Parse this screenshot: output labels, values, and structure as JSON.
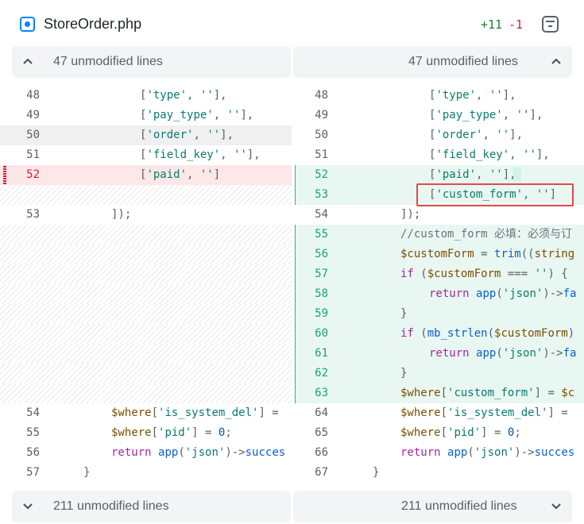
{
  "header": {
    "file_name": "StoreOrder.php",
    "additions": "+11",
    "deletions": "-1",
    "file_icon": "file-circle-icon",
    "collapse_icon": "collapse-icon"
  },
  "expand_top": {
    "left_label": "47 unmodified lines",
    "right_label": "47 unmodified lines",
    "icon": "chevron-up-icon"
  },
  "expand_bottom": {
    "left_label": "211 unmodified lines",
    "right_label": "211 unmodified lines",
    "icon": "chevron-down-icon"
  },
  "colors": {
    "addition": "#1a7f37",
    "deletion": "#cf222e",
    "added_line_bg": "#e8f7f1",
    "deleted_line_bg": "#fde7e8",
    "highlight_box": "#e5484d"
  },
  "left_lines": [
    {
      "num": "48",
      "code": "['type', ''],",
      "kind": "ctx"
    },
    {
      "num": "49",
      "code": "['pay_type', ''],",
      "kind": "ctx"
    },
    {
      "num": "50",
      "code": "['order', ''],",
      "kind": "ctx"
    },
    {
      "num": "51",
      "code": "['field_key', ''],",
      "kind": "ctx"
    },
    {
      "num": "52",
      "code": "['paid', '']",
      "kind": "del"
    },
    {
      "num": "",
      "code": "",
      "kind": "filler"
    },
    {
      "num": "53",
      "code": "]);",
      "kind": "ctx"
    },
    {
      "num": "",
      "code": "",
      "kind": "filler"
    },
    {
      "num": "",
      "code": "",
      "kind": "filler"
    },
    {
      "num": "",
      "code": "",
      "kind": "filler"
    },
    {
      "num": "",
      "code": "",
      "kind": "filler"
    },
    {
      "num": "",
      "code": "",
      "kind": "filler"
    },
    {
      "num": "",
      "code": "",
      "kind": "filler"
    },
    {
      "num": "",
      "code": "",
      "kind": "filler"
    },
    {
      "num": "",
      "code": "",
      "kind": "filler"
    },
    {
      "num": "",
      "code": "",
      "kind": "filler"
    },
    {
      "num": "54",
      "code": "$where['is_system_del'] = ",
      "kind": "ctx"
    },
    {
      "num": "55",
      "code": "$where['pid'] = 0;",
      "kind": "ctx"
    },
    {
      "num": "56",
      "code": "return app('json')->succes",
      "kind": "ctx"
    },
    {
      "num": "57",
      "code": "}",
      "kind": "ctx"
    }
  ],
  "right_lines": [
    {
      "num": "48",
      "code": "['type', ''],",
      "kind": "ctx"
    },
    {
      "num": "49",
      "code": "['pay_type', ''],",
      "kind": "ctx"
    },
    {
      "num": "50",
      "code": "['order', ''],",
      "kind": "ctx"
    },
    {
      "num": "51",
      "code": "['field_key', ''],",
      "kind": "ctx"
    },
    {
      "num": "52",
      "code": "['paid', ''],",
      "kind": "add"
    },
    {
      "num": "53",
      "code": "['custom_form', '']",
      "kind": "add"
    },
    {
      "num": "54",
      "code": "]);",
      "kind": "ctx"
    },
    {
      "num": "55",
      "code": "//custom_form 必填：必须与订",
      "kind": "add"
    },
    {
      "num": "56",
      "code": "$customForm = trim((string",
      "kind": "add"
    },
    {
      "num": "57",
      "code": "if ($customForm === '') {",
      "kind": "add"
    },
    {
      "num": "58",
      "code": "return app('json')->fa",
      "kind": "add"
    },
    {
      "num": "59",
      "code": "}",
      "kind": "add"
    },
    {
      "num": "60",
      "code": "if (mb_strlen($customForm)",
      "kind": "add"
    },
    {
      "num": "61",
      "code": "return app('json')->fa",
      "kind": "add"
    },
    {
      "num": "62",
      "code": "}",
      "kind": "add"
    },
    {
      "num": "63",
      "code": "$where['custom_form'] = $c",
      "kind": "add"
    },
    {
      "num": "64",
      "code": "$where['is_system_del'] = ",
      "kind": "ctx"
    },
    {
      "num": "65",
      "code": "$where['pid'] = 0;",
      "kind": "ctx"
    },
    {
      "num": "66",
      "code": "return app('json')->succes",
      "kind": "ctx"
    },
    {
      "num": "67",
      "code": "}",
      "kind": "ctx"
    }
  ]
}
